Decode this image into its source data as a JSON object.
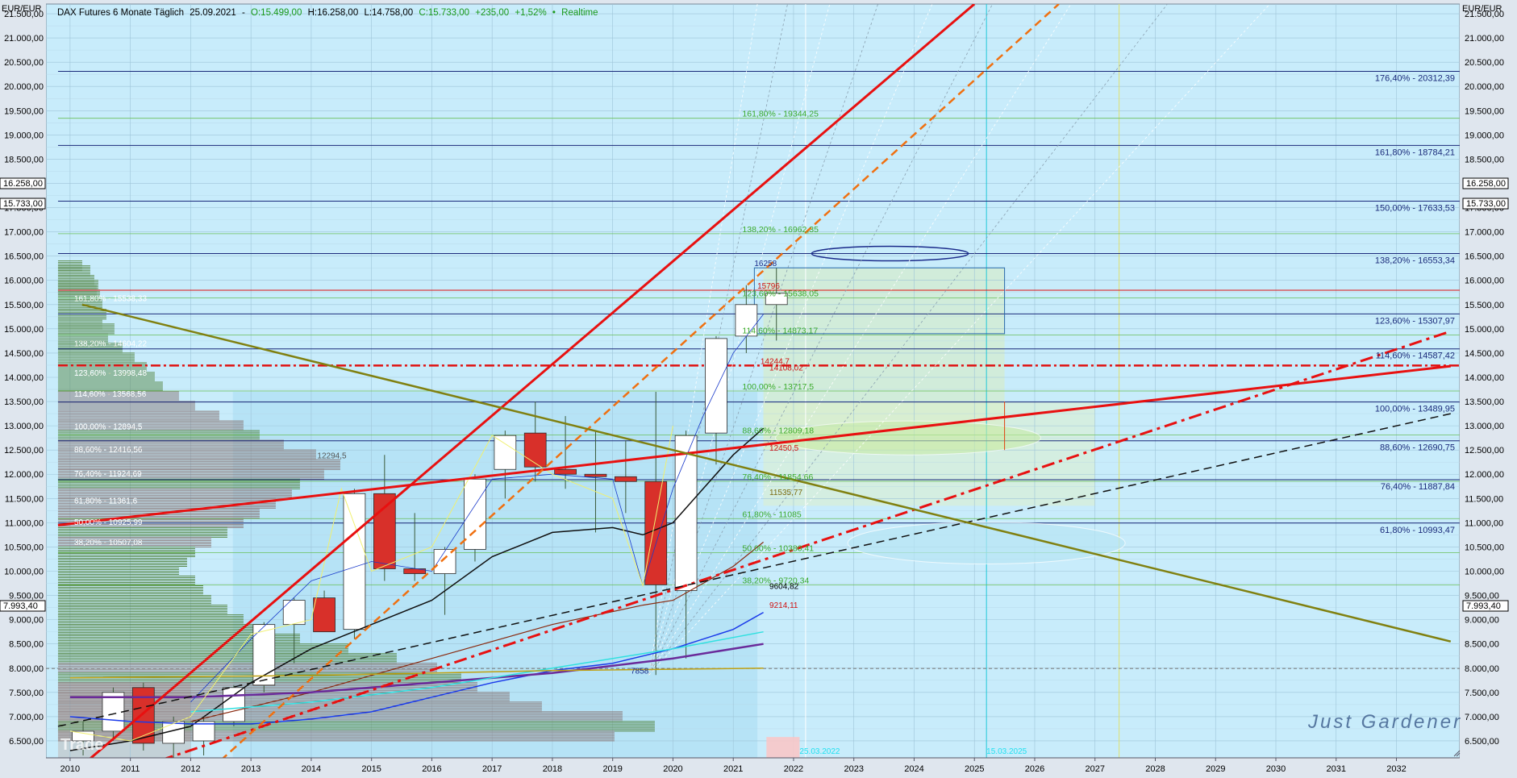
{
  "header": {
    "currency": "EUR/EUR",
    "title": "DAX Futures 6 Monate Täglich",
    "date": "25.09.2021",
    "sep": "-",
    "open": "O:15.499,00",
    "high": "H:16.258,00",
    "low": "L:14.758,00",
    "close": "C:15.733,00",
    "change": "+235,00",
    "change_pct": "+1,52%",
    "realtime": "Realtime"
  },
  "watermark": "Just Gardener",
  "logo": "Trade",
  "price_tags": {
    "high": "16.258,00",
    "last": "15.733,00",
    "ref": "7.993,40"
  },
  "chart_data": {
    "type": "candlestick",
    "x_labels": [
      "2010",
      "2011",
      "2012",
      "2013",
      "2014",
      "2015",
      "2016",
      "2017",
      "2018",
      "2019",
      "2020",
      "2021",
      "2022",
      "2023",
      "2024",
      "2025",
      "2026",
      "2027",
      "2028",
      "2029",
      "2030",
      "2031",
      "2032"
    ],
    "y_ticks": [
      "6.500,00",
      "7.000,00",
      "7.500,00",
      "8.000,00",
      "8.500,00",
      "9.000,00",
      "9.500,00",
      "10.000,00",
      "10.500,00",
      "11.000,00",
      "11.500,00",
      "12.000,00",
      "12.500,00",
      "13.000,00",
      "13.500,00",
      "14.000,00",
      "14.500,00",
      "15.000,00",
      "15.500,00",
      "16.000,00",
      "16.500,00",
      "17.000,00",
      "17.500,00",
      "18.000,00",
      "18.500,00",
      "19.000,00",
      "19.500,00",
      "20.000,00",
      "20.500,00",
      "21.000,00",
      "21.500,00"
    ],
    "y_range": [
      6150,
      21700
    ],
    "candles": [
      {
        "x": 2010.0,
        "o": 6500,
        "h": 6900,
        "l": 6200,
        "c": 6700
      },
      {
        "x": 2010.5,
        "o": 6700,
        "h": 7600,
        "l": 6500,
        "c": 7500
      },
      {
        "x": 2011.0,
        "o": 7600,
        "h": 7700,
        "l": 6300,
        "c": 6450
      },
      {
        "x": 2011.5,
        "o": 6450,
        "h": 7000,
        "l": 5900,
        "c": 6900
      },
      {
        "x": 2012.0,
        "o": 6500,
        "h": 7000,
        "l": 6200,
        "c": 6900
      },
      {
        "x": 2012.5,
        "o": 6900,
        "h": 7650,
        "l": 6800,
        "c": 7600
      },
      {
        "x": 2013.0,
        "o": 7650,
        "h": 8950,
        "l": 7500,
        "c": 8900
      },
      {
        "x": 2013.5,
        "o": 8900,
        "h": 9450,
        "l": 8100,
        "c": 9400
      },
      {
        "x": 2014.0,
        "o": 9450,
        "h": 9600,
        "l": 8800,
        "c": 8750
      },
      {
        "x": 2014.5,
        "o": 8800,
        "h": 11700,
        "l": 8600,
        "c": 11600
      },
      {
        "x": 2015.0,
        "o": 11600,
        "h": 12400,
        "l": 9800,
        "c": 10050
      },
      {
        "x": 2015.5,
        "o": 10050,
        "h": 11200,
        "l": 9800,
        "c": 9950
      },
      {
        "x": 2016.0,
        "o": 9950,
        "h": 10500,
        "l": 9100,
        "c": 10450
      },
      {
        "x": 2016.5,
        "o": 10450,
        "h": 12000,
        "l": 10200,
        "c": 11900
      },
      {
        "x": 2017.0,
        "o": 12100,
        "h": 12900,
        "l": 11500,
        "c": 12800
      },
      {
        "x": 2017.5,
        "o": 12850,
        "h": 13500,
        "l": 11850,
        "c": 12150
      },
      {
        "x": 2018.0,
        "o": 12100,
        "h": 13200,
        "l": 11700,
        "c": 12000
      },
      {
        "x": 2018.5,
        "o": 12000,
        "h": 12900,
        "l": 10800,
        "c": 11950
      },
      {
        "x": 2019.0,
        "o": 11950,
        "h": 12700,
        "l": 11200,
        "c": 11850
      },
      {
        "x": 2019.5,
        "o": 11850,
        "h": 13700,
        "l": 7858,
        "c": 9720
      },
      {
        "x": 2020.0,
        "o": 9600,
        "h": 12900,
        "l": 8200,
        "c": 12800
      },
      {
        "x": 2020.5,
        "o": 12850,
        "h": 14850,
        "l": 12200,
        "c": 14800
      },
      {
        "x": 2021.0,
        "o": 14850,
        "h": 15900,
        "l": 14500,
        "c": 15500
      },
      {
        "x": 2021.5,
        "o": 15500,
        "h": 16258,
        "l": 14758,
        "c": 15733
      }
    ],
    "left_fib_levels": [
      {
        "label": "161,80% - 15538,33",
        "value": 15538
      },
      {
        "label": "138,20% - 14604,22",
        "value": 14604
      },
      {
        "label": "123,60% - 13998,48",
        "value": 13998
      },
      {
        "label": "114,60% - 13568,56",
        "value": 13568
      },
      {
        "label": "100,00% - 12894,5",
        "value": 12894
      },
      {
        "label": "88,60% - 12416,56",
        "value": 12416
      },
      {
        "label": "76,40% - 11924,69",
        "value": 11924
      },
      {
        "label": "61,80% - 11361,6",
        "value": 11361
      },
      {
        "label": "50,00% - 10925,99",
        "value": 10925
      },
      {
        "label": "38,20% - 10507,08",
        "value": 10507
      }
    ],
    "right_fib_levels": [
      {
        "label": "176,40% - 20312,39",
        "value": 20312
      },
      {
        "label": "161,80% - 18784,21",
        "value": 18784
      },
      {
        "label": "150,00% - 17633,53",
        "value": 17633
      },
      {
        "label": "138,20% - 16553,34",
        "value": 16553
      },
      {
        "label": "123,60% - 15307,97",
        "value": 15308
      },
      {
        "label": "114,60% - 14587,42",
        "value": 14587
      },
      {
        "label": "100,00% - 13489,95",
        "value": 13490
      },
      {
        "label": "88,60% - 12690,75",
        "value": 12691
      },
      {
        "label": "76,40% - 11887,84",
        "value": 11888
      },
      {
        "label": "61,80% - 10993,47",
        "value": 10993
      }
    ],
    "mid_fib_levels": [
      {
        "label": "161,80% - 19344,25",
        "value": 19344
      },
      {
        "label": "138,20% - 16962,35",
        "value": 16962
      },
      {
        "label": "123,60% - 15638,05",
        "value": 15638
      },
      {
        "label": "114,60% - 14873,17",
        "value": 14873
      },
      {
        "label": "100,00% - 13717,5",
        "value": 13717
      },
      {
        "label": "88,60% - 12809,18",
        "value": 12809
      },
      {
        "label": "76,40% - 11854,66",
        "value": 11854
      },
      {
        "label": "61,80% - 11085",
        "value": 11085
      },
      {
        "label": "50,00% - 10380,41",
        "value": 10380
      },
      {
        "label": "38,20% - 9720,34",
        "value": 9720
      }
    ],
    "price_notes": [
      {
        "label": "16258",
        "x": 2021.35,
        "value": 16258,
        "color": "#1a2a8a"
      },
      {
        "label": "15796",
        "x": 2021.4,
        "value": 15796,
        "color": "#d01010"
      },
      {
        "label": "14244,7",
        "x": 2021.45,
        "value": 14244,
        "color": "#d01010"
      },
      {
        "label": "14108,02",
        "x": 2021.6,
        "value": 14108,
        "color": "#d01010"
      },
      {
        "label": "12450,5",
        "x": 2021.6,
        "value": 12450,
        "color": "#d01010"
      },
      {
        "label": "11535,77",
        "x": 2021.6,
        "value": 11535,
        "color": "#7a6a10"
      },
      {
        "label": "9604,82",
        "x": 2021.6,
        "value": 9604,
        "color": "#000000"
      },
      {
        "label": "9214,11",
        "x": 2021.6,
        "value": 9214,
        "color": "#d01010"
      },
      {
        "label": "12294,5",
        "x": 2014.1,
        "value": 12294,
        "color": "#555555"
      },
      {
        "label": "7858",
        "x": 2019.3,
        "value": 7858,
        "color": "#1a2a8a"
      }
    ],
    "date_notes": [
      {
        "label": "25.03.2022",
        "x": 2022.1
      },
      {
        "label": "15.03.2025",
        "x": 2025.2
      }
    ],
    "lines": [
      {
        "name": "red-up",
        "color": "#e81010",
        "style": "solid",
        "width": 3,
        "x1": 2010.3,
        "y1": 6100,
        "x2": 2025.0,
        "y2": 21700
      },
      {
        "name": "red-right",
        "color": "#e81010",
        "style": "solid",
        "width": 3,
        "x1": 2009.8,
        "y1": 10950,
        "x2": 2032.9,
        "y2": 14230
      },
      {
        "name": "red-dashdot",
        "color": "#e81010",
        "style": "dashdot",
        "width": 3,
        "x1": 2011.5,
        "y1": 6100,
        "x2": 2032.9,
        "y2": 14950
      },
      {
        "name": "orange-dashed",
        "color": "#f07010",
        "style": "dashed",
        "width": 2.5,
        "x1": 2012.5,
        "y1": 6100,
        "x2": 2026.4,
        "y2": 21700
      },
      {
        "name": "black-dashed",
        "color": "#101010",
        "style": "dashed",
        "width": 1.5,
        "x1": 2009.8,
        "y1": 6800,
        "x2": 2032.9,
        "y2": 13250
      },
      {
        "name": "olive-down",
        "color": "#808010",
        "style": "solid",
        "width": 2.5,
        "x1": 2010.2,
        "y1": 15500,
        "x2": 2032.9,
        "y2": 8550
      }
    ]
  }
}
